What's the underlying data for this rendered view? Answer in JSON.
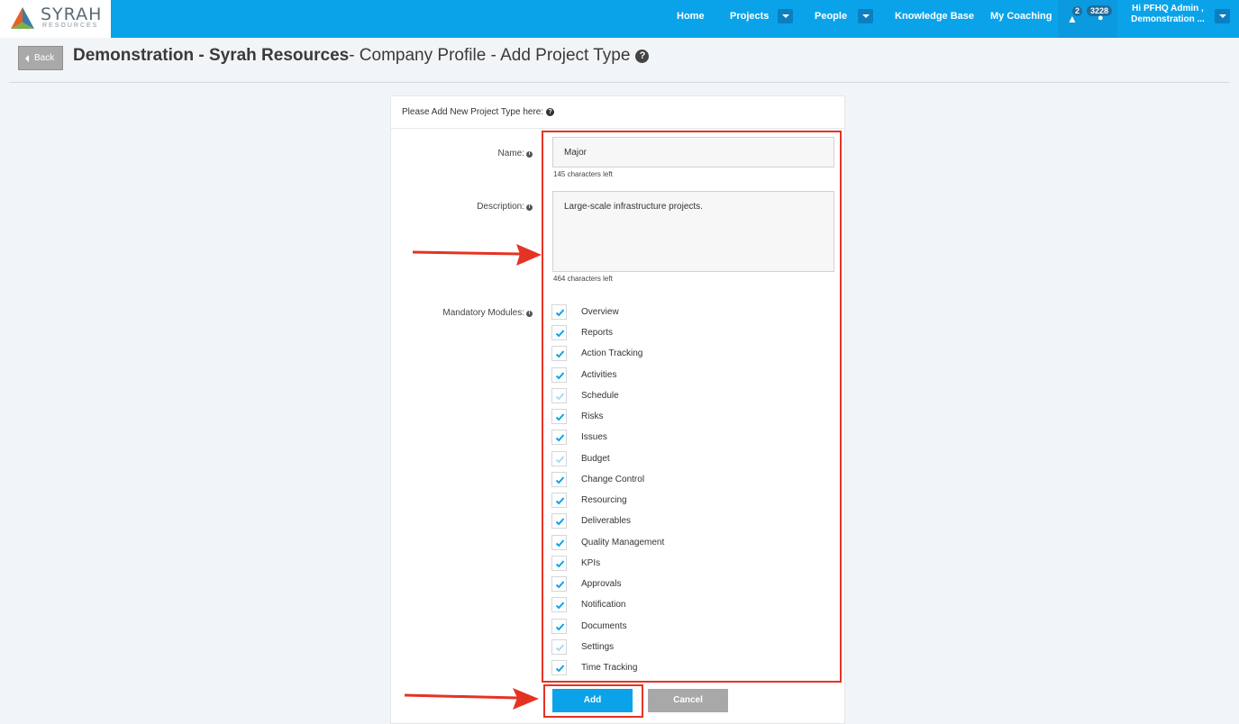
{
  "navbar": {
    "logo_text": "SYRAH",
    "logo_sub": "RESOURCES",
    "links": {
      "home": "Home",
      "projects": "Projects",
      "people": "People",
      "knowledge": "Knowledge Base",
      "coaching": "My Coaching"
    },
    "alert_count": "2",
    "message_count": "3228",
    "user_line1": "Hi PFHQ Admin ,",
    "user_line2": "Demonstration ..."
  },
  "header": {
    "back_label": "Back",
    "title_bold": "Demonstration - Syrah Resources",
    "title_rest": "- Company Profile - Add Project Type",
    "help_glyph": "?"
  },
  "form": {
    "heading": "Please Add New Project Type here:",
    "name_label": "Name:",
    "name_value": "Major",
    "name_chars_left": "145 characters left",
    "description_label": "Description:",
    "description_value": "Large-scale infrastructure projects.",
    "description_chars_left": "464 characters left",
    "modules_label": "Mandatory Modules:",
    "modules": [
      {
        "label": "Overview",
        "checked": true
      },
      {
        "label": "Reports",
        "checked": true
      },
      {
        "label": "Action Tracking",
        "checked": true
      },
      {
        "label": "Activities",
        "checked": true
      },
      {
        "label": "Schedule",
        "checked": false
      },
      {
        "label": "Risks",
        "checked": true
      },
      {
        "label": "Issues",
        "checked": true
      },
      {
        "label": "Budget",
        "checked": false
      },
      {
        "label": "Change Control",
        "checked": true
      },
      {
        "label": "Resourcing",
        "checked": true
      },
      {
        "label": "Deliverables",
        "checked": true
      },
      {
        "label": "Quality Management",
        "checked": true
      },
      {
        "label": "KPIs",
        "checked": true
      },
      {
        "label": "Approvals",
        "checked": true
      },
      {
        "label": "Notification",
        "checked": true
      },
      {
        "label": "Documents",
        "checked": true
      },
      {
        "label": "Settings",
        "checked": false
      },
      {
        "label": "Time Tracking",
        "checked": true
      }
    ],
    "add_label": "Add",
    "cancel_label": "Cancel"
  },
  "colors": {
    "brand": "#0aa3ea",
    "annotation": "#e53323",
    "check_on": "#0aa3ea",
    "check_off": "#a8daf2"
  }
}
